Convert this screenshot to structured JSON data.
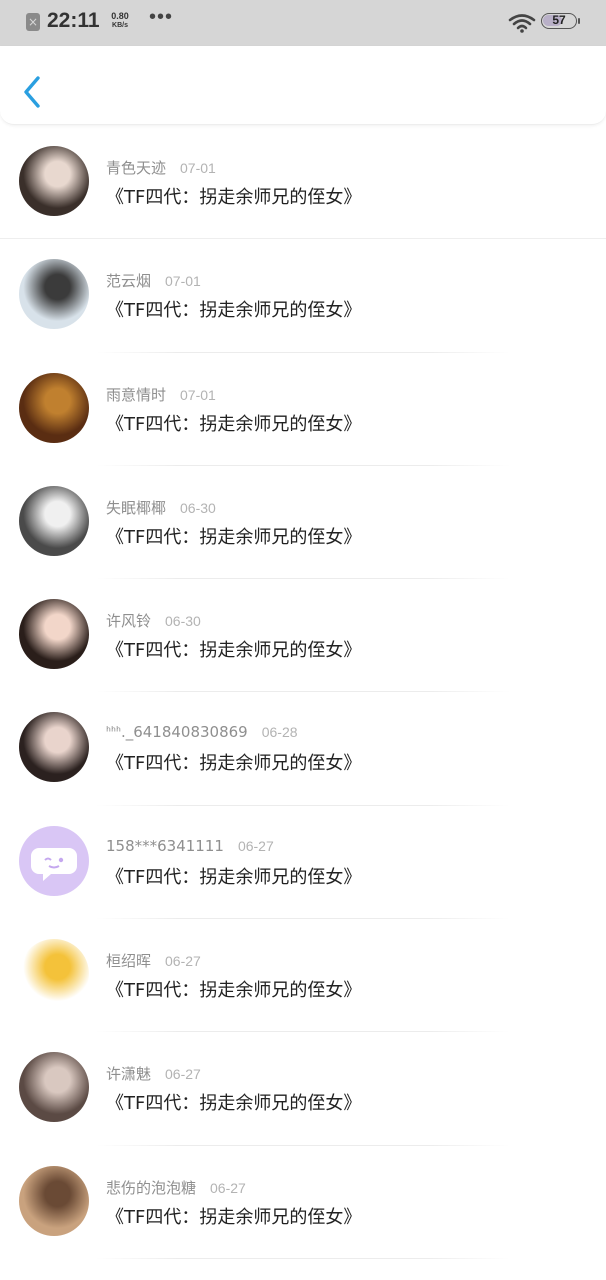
{
  "status_bar": {
    "time": "22:11",
    "speed_value": "0.80",
    "speed_unit": "KB/s",
    "dots": "•••",
    "battery": "57",
    "icons": [
      "close-notification-icon",
      "wifi-icon",
      "battery-icon"
    ]
  },
  "header": {
    "back_icon": "chevron-left-icon",
    "accent_color": "#2a9fe0"
  },
  "items": [
    {
      "name": "青色天迹",
      "date": "07-01",
      "title": "《TF四代：拐走余师兄的侄女》",
      "avatar_colors": [
        "#3a2f2a",
        "#e8d8cf"
      ]
    },
    {
      "name": "范云烟",
      "date": "07-01",
      "title": "《TF四代：拐走余师兄的侄女》",
      "avatar_colors": [
        "#d8e2ea",
        "#3b3b3b"
      ]
    },
    {
      "name": "雨意情时",
      "date": "07-01",
      "title": "《TF四代：拐走余师兄的侄女》",
      "avatar_colors": [
        "#5a2d12",
        "#c0802f"
      ]
    },
    {
      "name": "失眠椰椰",
      "date": "06-30",
      "title": "《TF四代：拐走余师兄的侄女》",
      "avatar_colors": [
        "#4a4a4a",
        "#f0f0f0"
      ]
    },
    {
      "name": "许风铃",
      "date": "06-30",
      "title": "《TF四代：拐走余师兄的侄女》",
      "avatar_colors": [
        "#2a1e1a",
        "#f2d6c9"
      ]
    },
    {
      "name": "ᑋᑋᑋ._641840830869",
      "date": "06-28",
      "title": "《TF四代：拐走余师兄的侄女》",
      "avatar_colors": [
        "#2b211f",
        "#e9d4cc"
      ]
    },
    {
      "name": "158***6341111",
      "date": "06-27",
      "title": "《TF四代：拐走余师兄的侄女》",
      "avatar_colors": [
        "#d9c6f5",
        "#ffffff"
      ]
    },
    {
      "name": "桓绍晖",
      "date": "06-27",
      "title": "《TF四代：拐走余师兄的侄女》",
      "avatar_colors": [
        "#ffffff",
        "#f4c23a"
      ]
    },
    {
      "name": "许潇魅",
      "date": "06-27",
      "title": "《TF四代：拐走余师兄的侄女》",
      "avatar_colors": [
        "#5b4a44",
        "#d9c8c0"
      ]
    },
    {
      "name": "悲伤的泡泡糖",
      "date": "06-27",
      "title": "《TF四代：拐走余师兄的侄女》",
      "avatar_colors": [
        "#c9a27e",
        "#6a4a35"
      ]
    }
  ]
}
